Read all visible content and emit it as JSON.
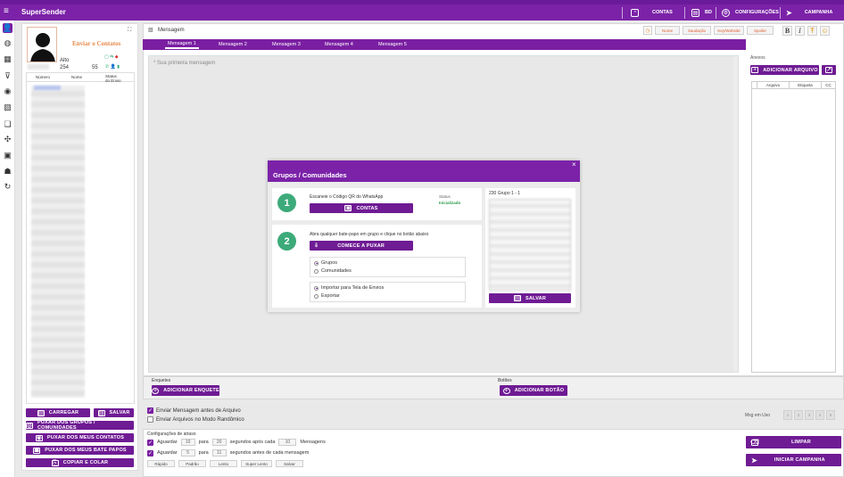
{
  "app": {
    "title": "SuperSender"
  },
  "header": {
    "contas": "CONTAS",
    "bd": "BD",
    "config": "CONFIGURAÇÕES",
    "campanha": "CAMPANHA"
  },
  "contacts_panel": {
    "title": "Enviar o Contatos",
    "label_alto": "Alto",
    "count": "254",
    "count2": "55",
    "columns": [
      "Número",
      "Nome",
      "Status do Envio"
    ]
  },
  "sidebar_buttons": {
    "carregar": "CARREGAR",
    "salvar": "SALVAR",
    "puxar_grupos": "PUXAR DOS GRUPOS / COMUNIDADES",
    "puxar_contatos": "PUXAR DOS MEUS CONTATOS",
    "puxar_bate": "PUXAR DOS MEUS BATE PAPOS",
    "copiar": "COPIAR E COLAR"
  },
  "message": {
    "title": "Mensagem",
    "tabs": [
      "Mensagem 1",
      "Mensagem 2",
      "Mensagem 3",
      "Mensagem 4",
      "Mensagem 5"
    ],
    "placeholder": "* Sua primeira mensagem",
    "tools": [
      "Nome",
      "Saudação",
      "Key/Website",
      "Spoiler"
    ]
  },
  "anexos": {
    "title": "Anexos",
    "add": "ADICIONAR ARQUIVO",
    "columns": [
      "Arquivo",
      "Etiqueta",
      "CC"
    ]
  },
  "enquetes": {
    "title": "Enquetes",
    "add": "ADICIONAR ENQUETE"
  },
  "botoes": {
    "title": "Botões",
    "add": "ADICIONAR BOTÃO"
  },
  "options": {
    "send_before": "Enviar Mensagem antes de Arquivo",
    "random": "Enviar Arquivos no Modo Randômico"
  },
  "msg_em_uso": {
    "label": "Msg em Uso",
    "pages": [
      "1",
      "2",
      "3",
      "4",
      "5"
    ]
  },
  "delay": {
    "title": "Configurações de atraso",
    "row1": {
      "label": "Aguardar",
      "a": "10",
      "para": "para",
      "b": "20",
      "text": "segundos após cada",
      "c": "10",
      "suffix": "Mensagens"
    },
    "row2": {
      "label": "Aguardar",
      "a": "5",
      "para": "para",
      "b": "11",
      "text": "segundos antes de cada mensagem"
    },
    "presets": [
      "Rápido",
      "Padrão",
      "Lento",
      "Super Lento",
      "Salvar"
    ]
  },
  "actions": {
    "limpar": "LIMPAR",
    "iniciar": "INICIAR CAMPANHA"
  },
  "modal": {
    "title": "Grupos / Comunidades",
    "close": "×",
    "step1": {
      "num": "1",
      "text": "Escaneie o Código QR do WhatsApp",
      "status_label": "Status",
      "status_value": "Inicializado",
      "button": "CONTAS"
    },
    "step2": {
      "num": "2",
      "text": "Abra qualquer bate-papo em grupo e clique no botão abaixo",
      "button": "COMECE A PUXAR"
    },
    "source": [
      "Grupos",
      "Comunidades"
    ],
    "dest": [
      "Importar para Tela de Envios",
      "Exportar"
    ],
    "group_header": "230 Grupo 1 - 1",
    "save": "SALVAR"
  },
  "colors": {
    "accent": "#7a1fa2",
    "green": "#3daa7a",
    "status_green": "#2e9b4b"
  }
}
